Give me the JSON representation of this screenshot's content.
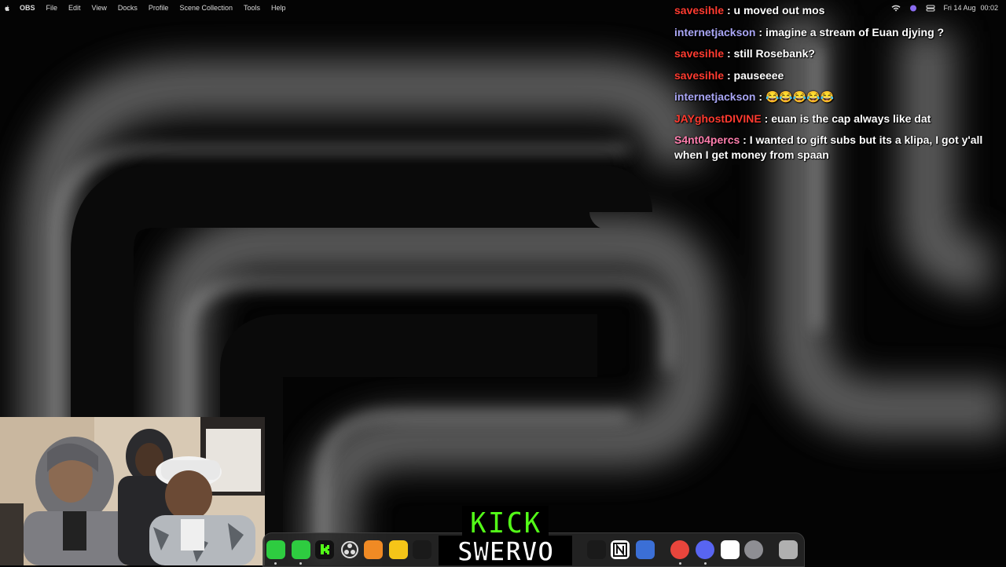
{
  "menubar": {
    "app_name": "OBS",
    "items": [
      "File",
      "Edit",
      "View",
      "Docks",
      "Profile",
      "Scene Collection",
      "Tools",
      "Help"
    ],
    "date": "Fri 14 Aug",
    "time": "00:02"
  },
  "chat": {
    "separator": ":",
    "messages": [
      {
        "user": "savesihle",
        "color": "#ff3b30",
        "text": "u moved out mos"
      },
      {
        "user": "internetjackson",
        "color": "#a9a6f5",
        "text": "imagine a stream of Euan djying ?"
      },
      {
        "user": "savesihle",
        "color": "#ff3b30",
        "text": "still Rosebank?"
      },
      {
        "user": "savesihle",
        "color": "#ff3b30",
        "text": "pauseeee"
      },
      {
        "user": "internetjackson",
        "color": "#a9a6f5",
        "text": "😂😂😂😂😂"
      },
      {
        "user": "JAYghostDIVINE",
        "color": "#ff3b30",
        "text": "euan is the cap always like dat"
      },
      {
        "user": "S4nt04percs",
        "color": "#ff7fae",
        "text": "I wanted to gift subs but its a klipa, I got y'all when I get money from spaan"
      }
    ]
  },
  "overlay": {
    "kick_text": "KICK",
    "channel_name": "SWERVO",
    "kick_green": "#53fc18"
  },
  "dock": {
    "icons": [
      {
        "name": "messages-icon",
        "color": "#2ecc40"
      },
      {
        "name": "facetime-icon",
        "color": "#2ecc40"
      },
      {
        "name": "kick-app-icon",
        "color": "#111111"
      },
      {
        "name": "obs-icon",
        "color": "#2b2b2b"
      },
      {
        "name": "fl-studio-icon",
        "color": "#f08a24"
      },
      {
        "name": "notes-icon",
        "color": "#f5c518"
      },
      {
        "name": "capcut-icon",
        "color": "#1a1a1a"
      },
      {
        "name": "notion-icon",
        "color": "#ffffff"
      },
      {
        "name": "roblox-icon",
        "color": "#3b6fd6"
      },
      {
        "name": "chrome-icon",
        "color": "#e8453c"
      },
      {
        "name": "discord-icon",
        "color": "#5865f2"
      },
      {
        "name": "photo-app-icon",
        "color": "#ffffff"
      },
      {
        "name": "system-settings-icon",
        "color": "#8e8e93"
      },
      {
        "name": "trash-icon",
        "color": "#b0b0b0"
      }
    ]
  }
}
